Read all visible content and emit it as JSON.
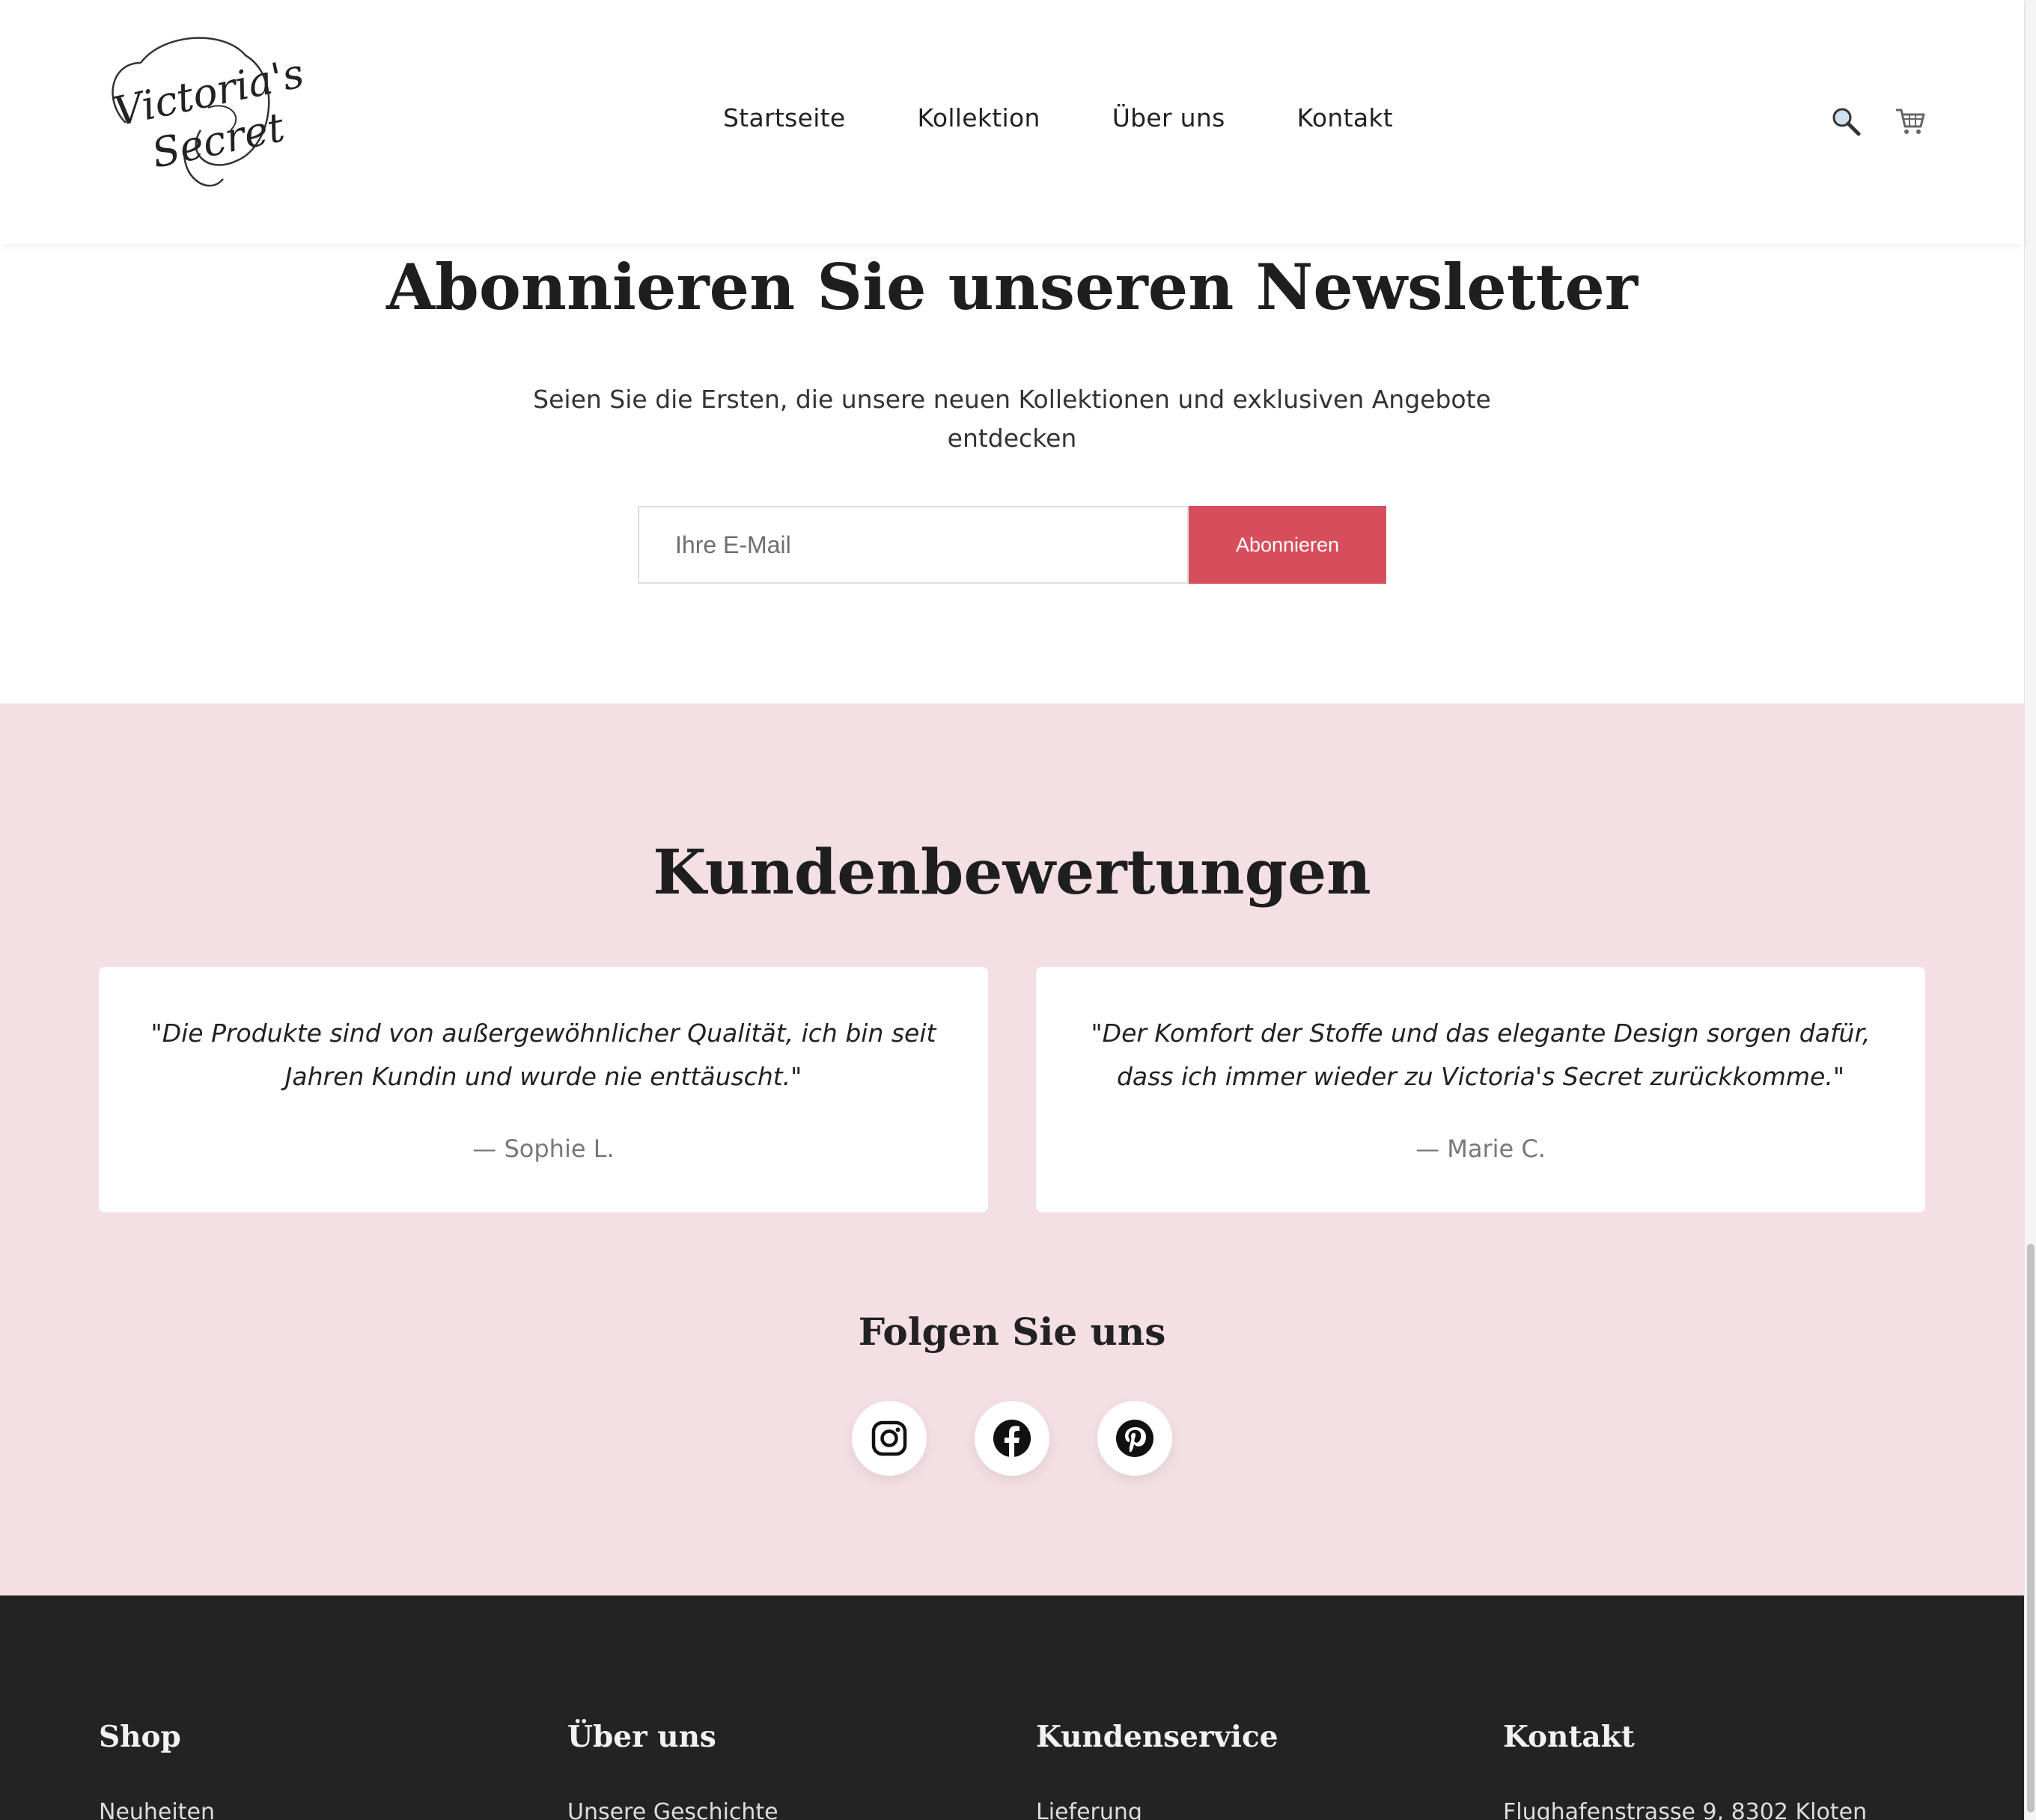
{
  "header": {
    "logo_line1": "Victoria's",
    "logo_line2": "Secret",
    "nav": [
      {
        "label": "Startseite"
      },
      {
        "label": "Kollektion"
      },
      {
        "label": "Über uns"
      },
      {
        "label": "Kontakt"
      }
    ],
    "icons": [
      "search-icon",
      "cart-icon"
    ]
  },
  "newsletter": {
    "title": "Abonnieren Sie unseren Newsletter",
    "subtitle": "Seien Sie die Ersten, die unsere neuen Kollektionen und exklusiven Angebote entdecken",
    "email_placeholder": "Ihre E-Mail",
    "button_label": "Abonnieren"
  },
  "reviews": {
    "title": "Kundenbewertungen",
    "items": [
      {
        "quote": "\"Die Produkte sind von außergewöhnlicher Qualität, ich bin seit Jahren Kundin und wurde nie enttäuscht.\"",
        "author": "— Sophie L."
      },
      {
        "quote": "\"Der Komfort der Stoffe und das elegante Design sorgen dafür, dass ich immer wieder zu Victoria's Secret zurückkomme.\"",
        "author": "— Marie C."
      }
    ],
    "follow_title": "Folgen Sie uns",
    "social": [
      "instagram-icon",
      "facebook-icon",
      "pinterest-icon"
    ]
  },
  "footer": {
    "columns": [
      {
        "heading": "Shop",
        "first_link": "Neuheiten"
      },
      {
        "heading": "Über uns",
        "first_link": "Unsere Geschichte"
      },
      {
        "heading": "Kundenservice",
        "first_link": "Lieferung"
      },
      {
        "heading": "Kontakt",
        "first_link": "Flughafenstrasse 9, 8302 Kloten"
      }
    ]
  },
  "colors": {
    "accent": "#d64e5c",
    "reviews_bg": "#f4e0e4",
    "footer_bg": "#232323"
  }
}
